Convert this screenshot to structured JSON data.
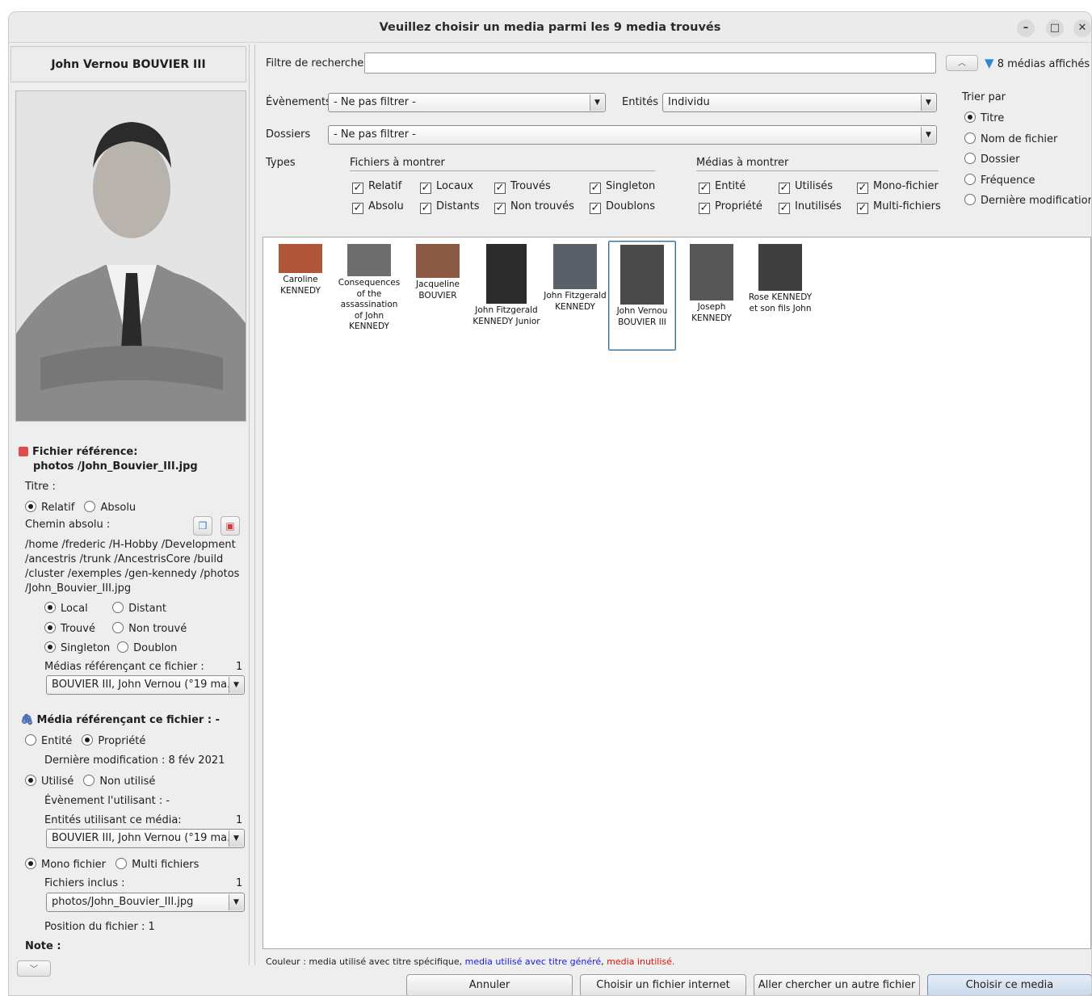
{
  "window": {
    "title": "Veuillez choisir un media parmi les 9 media trouvés",
    "controls": {
      "minimize": "–",
      "maximize": "□",
      "close": "✕"
    }
  },
  "left": {
    "entity_name": "John Vernou BOUVIER III",
    "file_ref_label": "Fichier référence:",
    "file_ref_path": "photos /John_Bouvier_III.jpg",
    "title_label": "Titre :",
    "relatif": "Relatif",
    "absolu": "Absolu",
    "abs_path_label": "Chemin absolu :",
    "abs_path_lines": [
      "/home /frederic /H-Hobby /Development",
      "/ancestris /trunk /AncestrisCore /build",
      "/cluster /exemples /gen-kennedy /photos",
      "/John_Bouvier_III.jpg"
    ],
    "local": "Local",
    "distant": "Distant",
    "trouve": "Trouvé",
    "non_trouve": "Non trouvé",
    "singleton": "Singleton",
    "doublon": "Doublon",
    "medias_ref_label": "Médias référençant ce fichier :",
    "medias_ref_count": "1",
    "medias_ref_value": "BOUVIER III, John Vernou (°19 ma...",
    "media_ref_header": "Média référençant ce fichier :  -",
    "entite": "Entité",
    "propriete": "Propriété",
    "last_mod": "Dernière modification : 8 fév 2021",
    "utilise": "Utilisé",
    "non_utilise": "Non utilisé",
    "event_using": "Évènement l'utilisant : -",
    "entities_using_label": "Entités utilisant ce média:",
    "entities_using_count": "1",
    "entities_using_value": "BOUVIER III, John Vernou (°19 ma...",
    "mono": "Mono fichier",
    "multi": "Multi fichiers",
    "files_included_label": "Fichiers inclus :",
    "files_included_count": "1",
    "files_included_value": "photos/John_Bouvier_III.jpg",
    "file_position": "Position du fichier : 1",
    "note_label": "Note :"
  },
  "filters": {
    "search_label": "Filtre de recherche",
    "search_value": "",
    "shown_count": "8 médias affichés",
    "events_label": "Évènements",
    "events_value": "- Ne pas filtrer -",
    "entities_label": "Entités",
    "entities_value": "Individu",
    "folders_label": "Dossiers",
    "folders_value": "- Ne pas filtrer -",
    "types_label": "Types",
    "files_to_show": "Fichiers à montrer",
    "medias_to_show": "Médias à montrer",
    "file_checks": [
      "Relatif",
      "Locaux",
      "Trouvés",
      "Singleton",
      "Absolu",
      "Distants",
      "Non trouvés",
      "Doublons"
    ],
    "media_checks": [
      "Entité",
      "Utilisés",
      "Mono-fichier",
      "Propriété",
      "Inutilisés",
      "Multi-fichiers"
    ],
    "sort_label": "Trier par",
    "sort_options": [
      "Titre",
      "Nom de fichier",
      "Dossier",
      "Fréquence",
      "Dernière modification"
    ]
  },
  "thumbnails": [
    {
      "label": "Caroline KENNEDY",
      "color": "#b0573a"
    },
    {
      "label": "Consequences of the assassination of John KENNEDY",
      "color": "#6e6e6e"
    },
    {
      "label": "Jacqueline BOUVIER",
      "color": "#8a5a45"
    },
    {
      "label": "John Fitzgerald KENNEDY Junior",
      "color": "#2c2c2c"
    },
    {
      "label": "John Fitzgerald KENNEDY",
      "color": "#5a5f6a"
    },
    {
      "label": "John Vernou BOUVIER III",
      "color": "#4a4a4a"
    },
    {
      "label": "Joseph KENNEDY",
      "color": "#575757"
    },
    {
      "label": "Rose KENNEDY et son fils John",
      "color": "#3f3f3f"
    }
  ],
  "legend": {
    "prefix": "Couleur : media utilisé avec titre spécifique, ",
    "blue": "media utilisé avec titre généré",
    "comma": ", ",
    "red": "media inutilisé.",
    "blue_color": "#1a1ad6",
    "red_color": "#e01010"
  },
  "buttons": {
    "cancel": "Annuler",
    "internet": "Choisir un fichier internet",
    "other": "Aller chercher un autre fichier",
    "choose": "Choisir ce media"
  }
}
